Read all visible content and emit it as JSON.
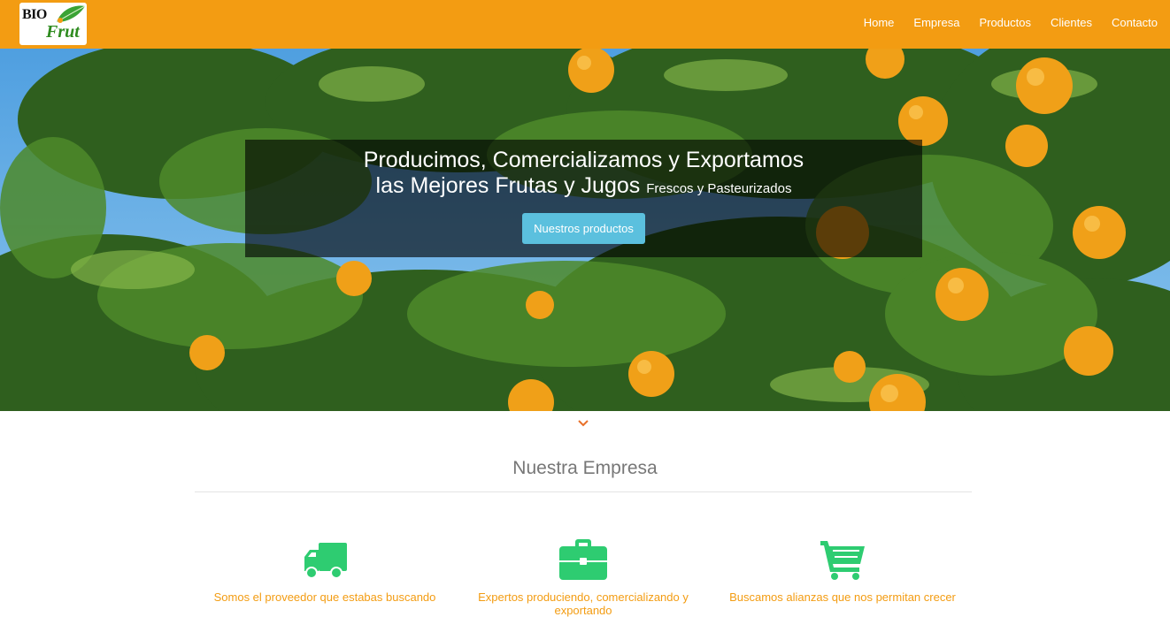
{
  "brand": {
    "logo_top": "BIO",
    "logo_bottom": "Frut"
  },
  "nav": {
    "items": [
      {
        "label": "Home"
      },
      {
        "label": "Empresa"
      },
      {
        "label": "Productos"
      },
      {
        "label": "Clientes"
      },
      {
        "label": "Contacto"
      }
    ]
  },
  "hero": {
    "line1": "Producimos, Comercializamos y Exportamos",
    "line2": "las Mejores Frutas y Jugos",
    "line2_small": "Frescos y Pasteurizados",
    "button_label": "Nuestros productos"
  },
  "section": {
    "title": "Nuestra Empresa",
    "features": [
      {
        "icon": "truck-icon",
        "text": "Somos el proveedor que estabas buscando"
      },
      {
        "icon": "briefcase-icon",
        "text": "Expertos produciendo, comercializando y exportando"
      },
      {
        "icon": "shopping-cart-icon",
        "text": "Buscamos alianzas que nos permitan crecer"
      }
    ]
  },
  "colors": {
    "navbar": "#f39c12",
    "accent_green": "#2ecc71",
    "feature_text": "#f39c12",
    "button": "#5bc0de",
    "chevron": "#e8702a"
  }
}
